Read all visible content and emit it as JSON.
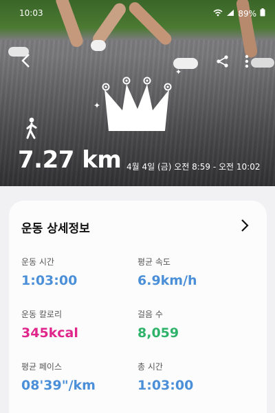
{
  "status_bar": {
    "time": "10:03",
    "battery": "89%"
  },
  "activity": {
    "distance": "7.27 km",
    "datetime": "4월 4일 (금) 오전 8:59 - 오전 10:02"
  },
  "details": {
    "title": "운동 상세정보",
    "metrics": [
      {
        "label": "운동 시간",
        "value": "1:03:00",
        "color": "#4a8fd8"
      },
      {
        "label": "평균 속도",
        "value": "6.9km/h",
        "color": "#4a8fd8"
      },
      {
        "label": "운동 칼로리",
        "value": "345kcal",
        "color": "#e0268a"
      },
      {
        "label": "걸음 수",
        "value": "8,059",
        "color": "#2fb36b"
      },
      {
        "label": "평균 페이스",
        "value": "08'39\"/km",
        "color": "#4a8fd8"
      },
      {
        "label": "총 시간",
        "value": "1:03:00",
        "color": "#4a8fd8"
      }
    ]
  },
  "icons": [
    "back-icon",
    "share-icon",
    "more-icon",
    "crown-icon",
    "walking-icon",
    "chevron-right-icon"
  ]
}
